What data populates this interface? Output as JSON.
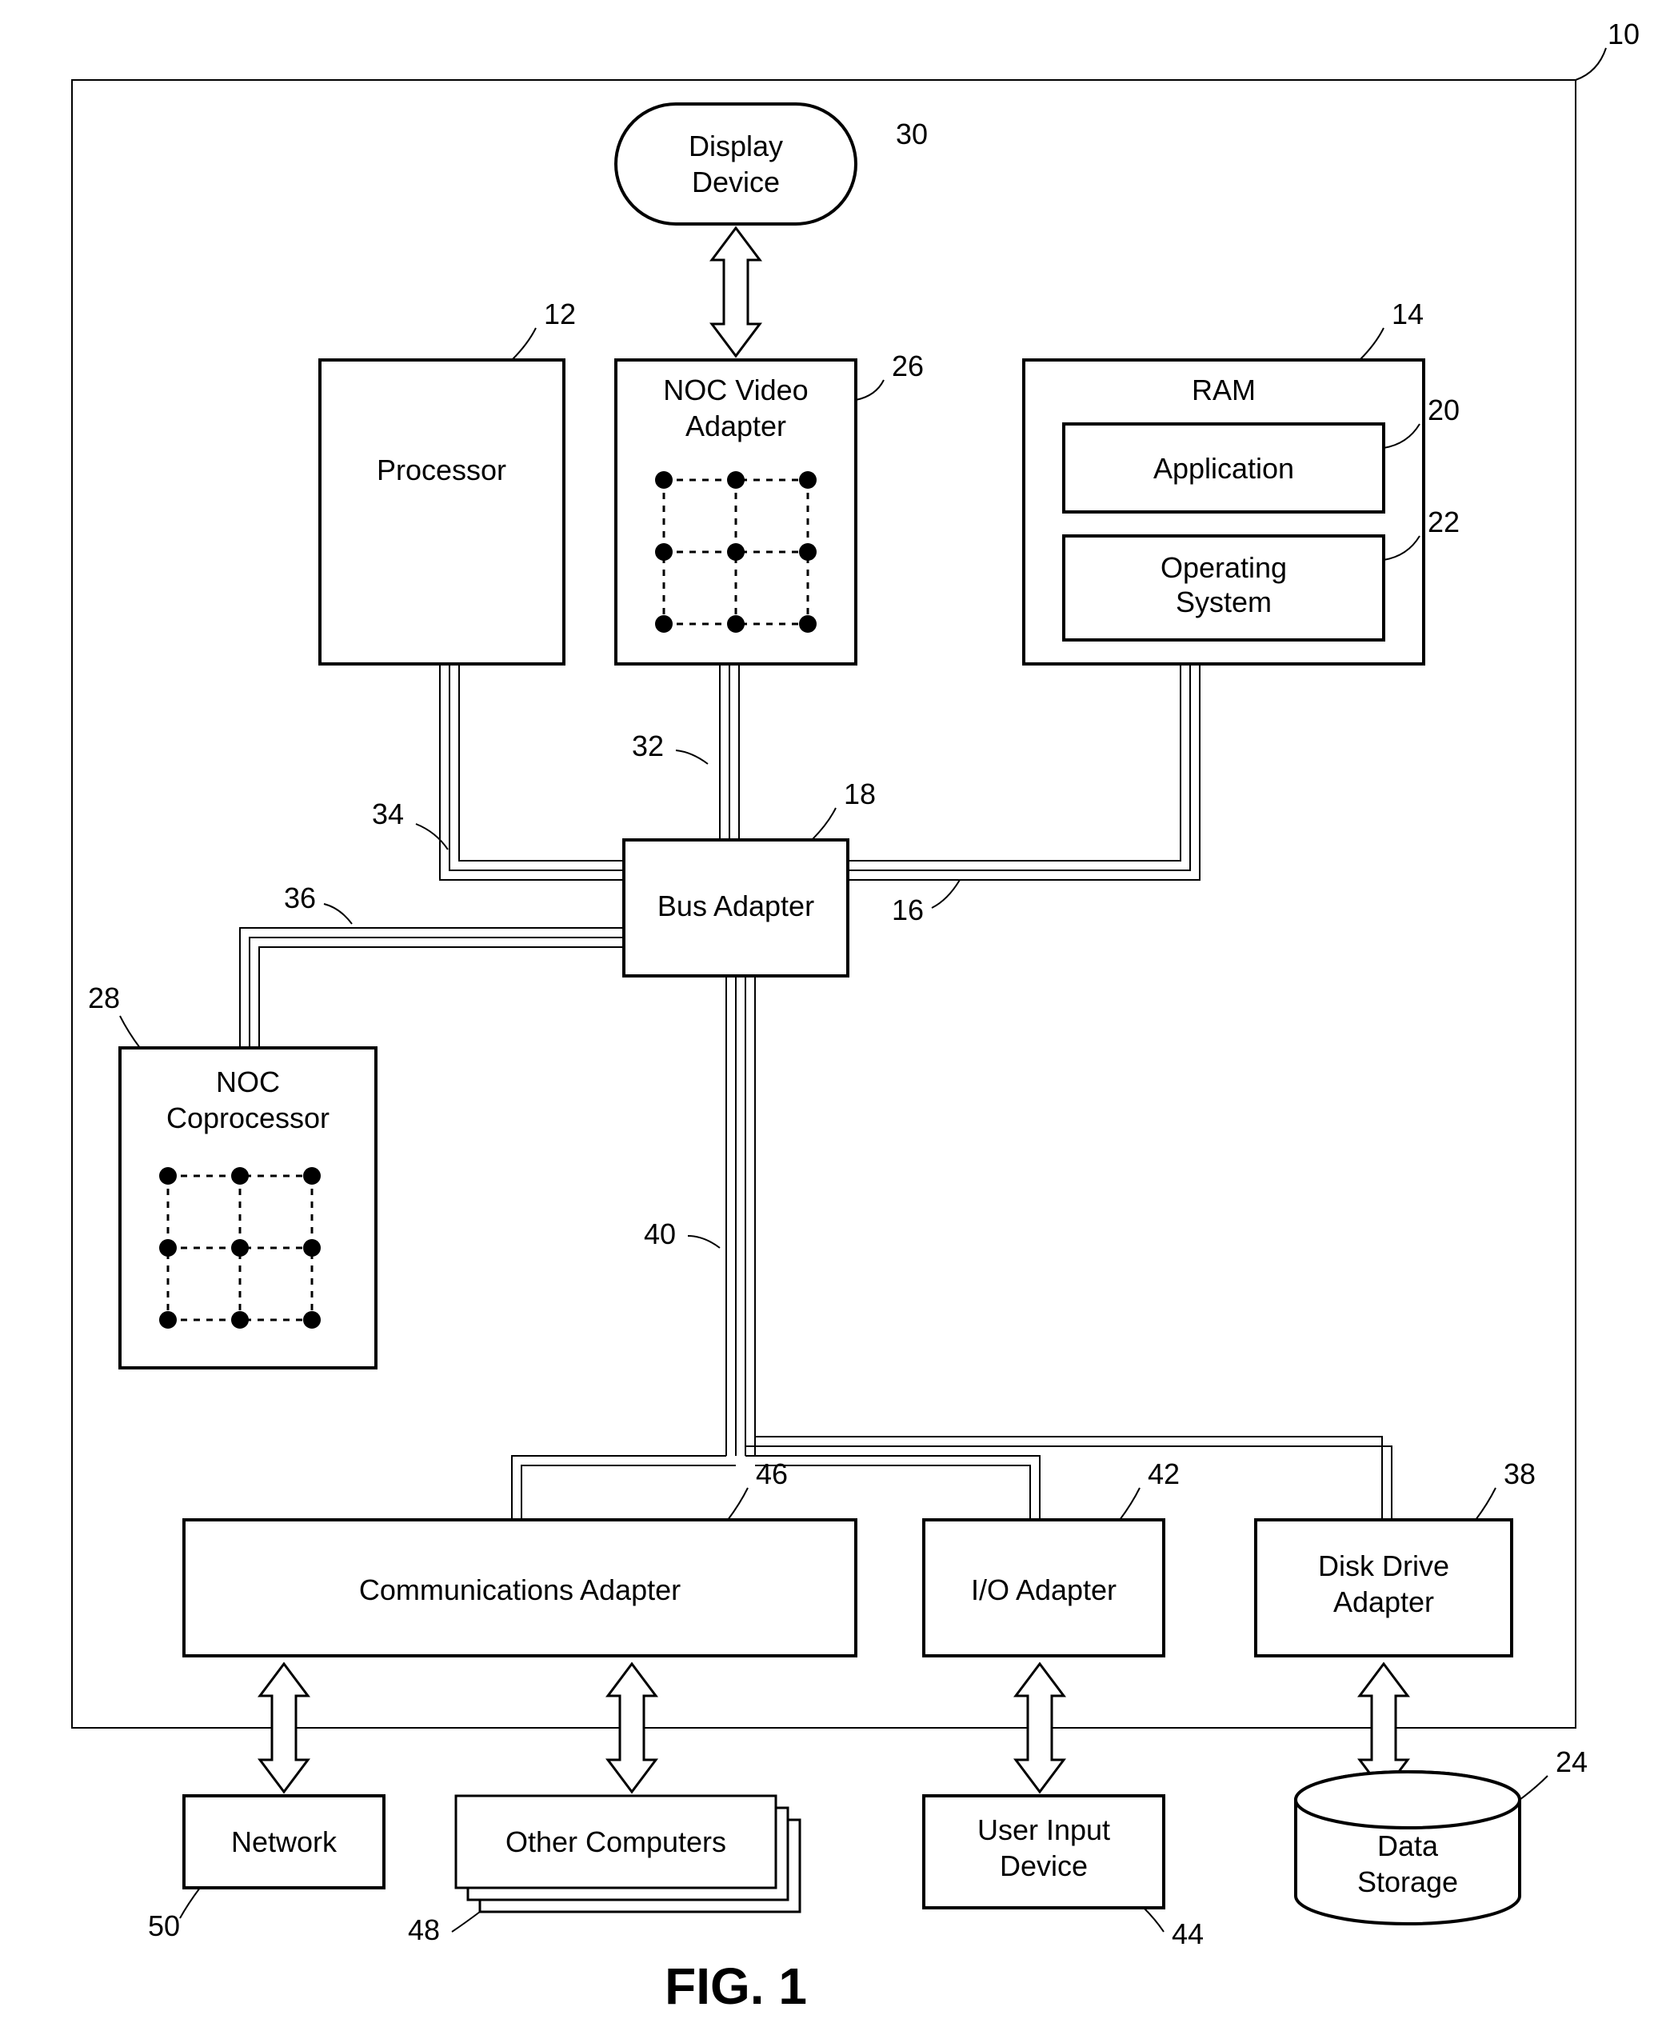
{
  "figure_title": "FIG. 1",
  "refs": {
    "system": "10",
    "processor": "12",
    "ram": "14",
    "ram_bus": "16",
    "bus_adapter": "18",
    "application": "20",
    "os": "22",
    "data_storage": "24",
    "noc_video": "26",
    "noc_coproc": "28",
    "display": "30",
    "fsb_video": "32",
    "fsb_proc": "34",
    "fsb_coproc": "36",
    "disk_adapter": "38",
    "exp_bus": "40",
    "io_adapter": "42",
    "user_input": "44",
    "comm_adapter": "46",
    "other_computers": "48",
    "network": "50"
  },
  "labels": {
    "display_l1": "Display",
    "display_l2": "Device",
    "processor": "Processor",
    "noc_video_l1": "NOC Video",
    "noc_video_l2": "Adapter",
    "ram": "RAM",
    "application": "Application",
    "os_l1": "Operating",
    "os_l2": "System",
    "bus_adapter": "Bus Adapter",
    "noc_coproc_l1": "NOC",
    "noc_coproc_l2": "Coprocessor",
    "comm_adapter": "Communications Adapter",
    "io_adapter": "I/O Adapter",
    "disk_adapter_l1": "Disk Drive",
    "disk_adapter_l2": "Adapter",
    "network": "Network",
    "other_computers": "Other Computers",
    "user_input_l1": "User Input",
    "user_input_l2": "Device",
    "data_storage_l1": "Data",
    "data_storage_l2": "Storage"
  }
}
